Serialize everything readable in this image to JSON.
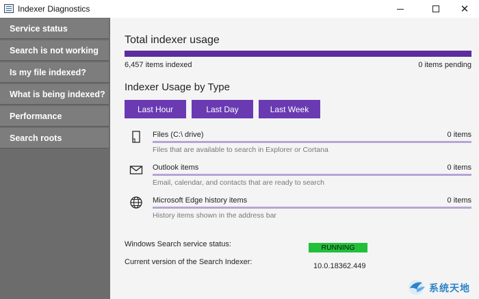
{
  "window": {
    "title": "Indexer Diagnostics"
  },
  "sidebar": {
    "items": [
      {
        "label": "Service status"
      },
      {
        "label": "Search is not working"
      },
      {
        "label": "Is my file indexed?"
      },
      {
        "label": "What is being indexed?"
      },
      {
        "label": "Performance"
      },
      {
        "label": "Search roots"
      }
    ]
  },
  "main": {
    "total_title": "Total indexer usage",
    "items_indexed": "6,457 items indexed",
    "items_pending": "0 items pending",
    "usage_by_type_title": "Indexer Usage by Type",
    "tabs": [
      {
        "label": "Last Hour"
      },
      {
        "label": "Last Day"
      },
      {
        "label": "Last Week"
      }
    ],
    "usage_rows": [
      {
        "icon": "file-icon",
        "name": "Files (C:\\ drive)",
        "count": "0 items",
        "description": "Files that are available to search in Explorer or Cortana"
      },
      {
        "icon": "mail-icon",
        "name": "Outlook items",
        "count": "0 items",
        "description": "Email, calendar, and contacts that are ready to search"
      },
      {
        "icon": "globe-icon",
        "name": "Microsoft Edge history items",
        "count": "0 items",
        "description": "History items shown in the address bar"
      }
    ],
    "service_status_label": "Windows Search service status:",
    "service_status_value": "RUNNING",
    "version_label": "Current version of the Search Indexer:",
    "version_value": "10.0.18362.449"
  },
  "colors": {
    "accent": "#6a3ab2",
    "usage_bar": "#5b2d9e",
    "status_running": "#22c03a",
    "sidebar": "#7d7d7d"
  },
  "watermark": {
    "text": "系统天地"
  }
}
